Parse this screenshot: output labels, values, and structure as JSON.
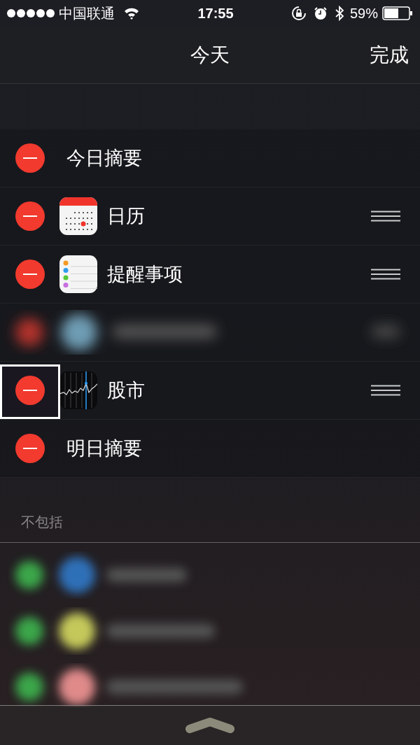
{
  "status_bar": {
    "carrier": "中国联通",
    "time": "17:55",
    "battery_percent": "59%"
  },
  "nav": {
    "title": "今天",
    "done": "完成"
  },
  "included": [
    {
      "kind": "summary",
      "label": "今日摘要",
      "reorderable": false,
      "highlighted": false
    },
    {
      "kind": "calendar",
      "label": "日历",
      "reorderable": true,
      "highlighted": false
    },
    {
      "kind": "reminders",
      "label": "提醒事项",
      "reorderable": true,
      "highlighted": false
    },
    {
      "kind": "blurred",
      "reorderable": true,
      "highlighted": false
    },
    {
      "kind": "stocks",
      "label": "股市",
      "reorderable": true,
      "highlighted": true
    },
    {
      "kind": "summary",
      "label": "明日摘要",
      "reorderable": false,
      "highlighted": false
    }
  ],
  "excluded": {
    "header": "不包括",
    "rows": [
      {
        "color": "#2f6fb8"
      },
      {
        "color": "#c4c85a"
      },
      {
        "color": "#e08a8a"
      }
    ]
  }
}
